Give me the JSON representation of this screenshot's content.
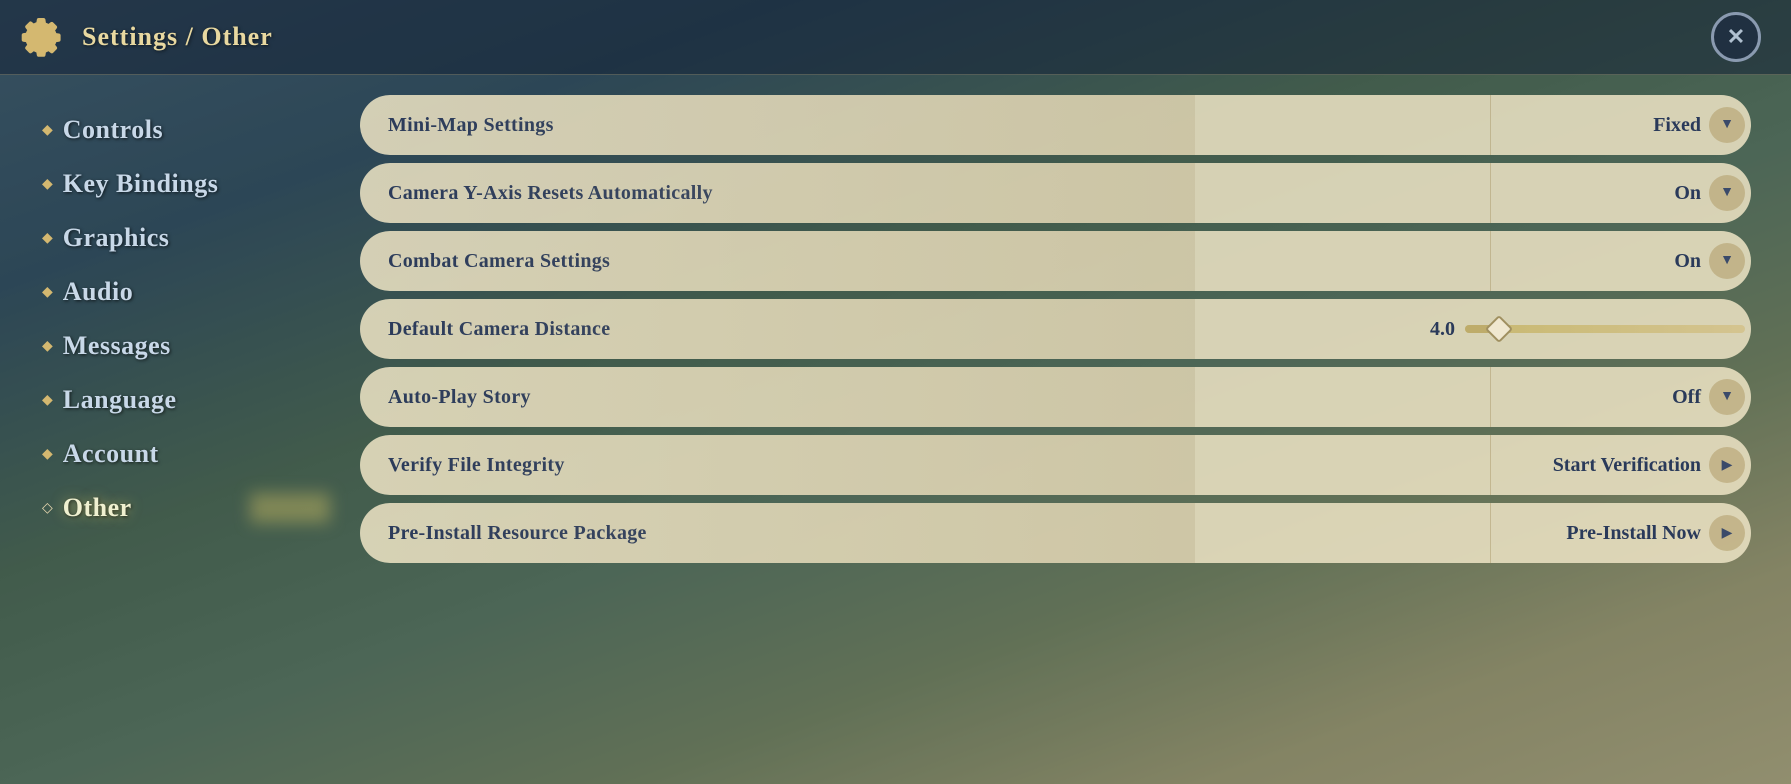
{
  "header": {
    "title": "Settings / Other",
    "close_label": "✕"
  },
  "sidebar": {
    "items": [
      {
        "id": "controls",
        "label": "Controls",
        "active": false,
        "bullet": "◆"
      },
      {
        "id": "key-bindings",
        "label": "Key Bindings",
        "active": false,
        "bullet": "◆"
      },
      {
        "id": "graphics",
        "label": "Graphics",
        "active": false,
        "bullet": "◆"
      },
      {
        "id": "audio",
        "label": "Audio",
        "active": false,
        "bullet": "◆"
      },
      {
        "id": "messages",
        "label": "Messages",
        "active": false,
        "bullet": "◆"
      },
      {
        "id": "language",
        "label": "Language",
        "active": false,
        "bullet": "◆"
      },
      {
        "id": "account",
        "label": "Account",
        "active": false,
        "bullet": "◆"
      },
      {
        "id": "other",
        "label": "Other",
        "active": true,
        "bullet": "◇"
      }
    ]
  },
  "settings": [
    {
      "id": "minimap",
      "label": "Mini-Map Settings",
      "type": "dropdown",
      "value": "Fixed"
    },
    {
      "id": "camera-y-axis",
      "label": "Camera Y-Axis Resets Automatically",
      "type": "dropdown",
      "value": "On"
    },
    {
      "id": "combat-camera",
      "label": "Combat Camera Settings",
      "type": "dropdown",
      "value": "On"
    },
    {
      "id": "camera-distance",
      "label": "Default Camera Distance",
      "type": "slider",
      "value": "4.0",
      "slider_percent": 12
    },
    {
      "id": "autoplay-story",
      "label": "Auto-Play Story",
      "type": "dropdown",
      "value": "Off"
    },
    {
      "id": "verify-integrity",
      "label": "Verify File Integrity",
      "type": "action",
      "value": "Start Verification"
    },
    {
      "id": "preinstall",
      "label": "Pre-Install Resource Package",
      "type": "action",
      "value": "Pre-Install Now"
    }
  ],
  "icons": {
    "gear": "⚙",
    "arrow_down": "▼",
    "arrow_right": "▶"
  }
}
